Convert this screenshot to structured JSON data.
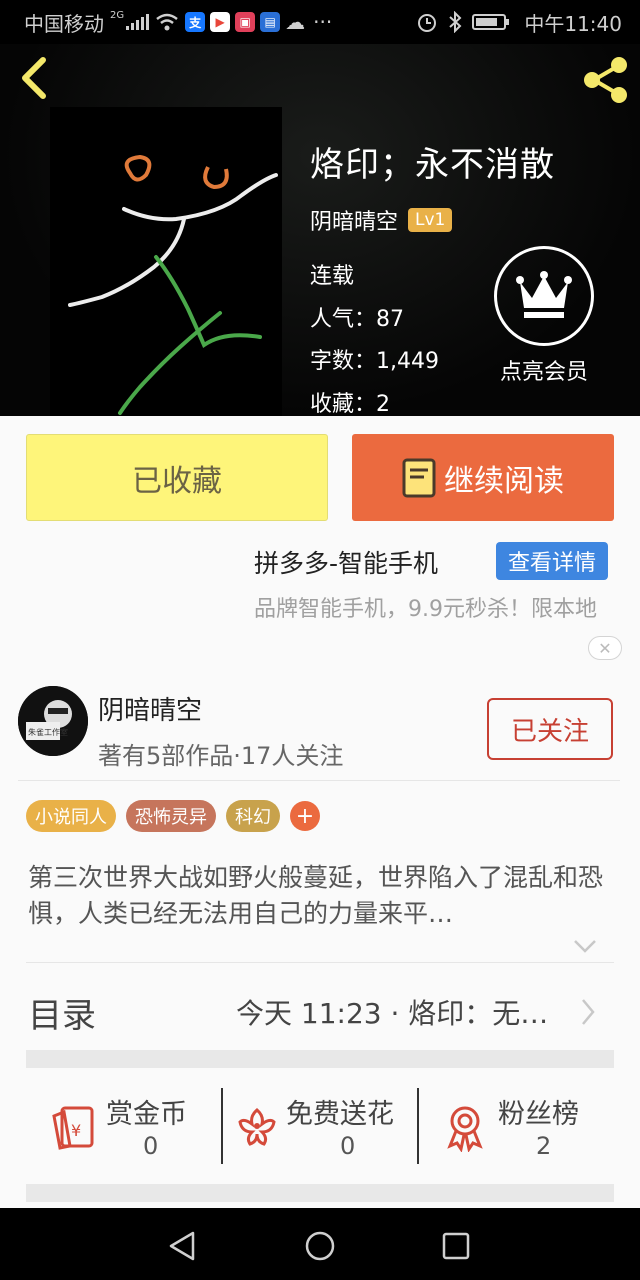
{
  "status_bar": {
    "carrier": "中国移动",
    "network": "2G",
    "time": "中午11:40",
    "more": "···",
    "app_icons": [
      {
        "name": "alipay-icon",
        "glyph": "支",
        "color": "#1677ff"
      },
      {
        "name": "video-app-icon",
        "glyph": "▶",
        "color": "#ffffff"
      },
      {
        "name": "shop-app-icon",
        "glyph": "▣",
        "color": "#e0405a"
      },
      {
        "name": "news-app-icon",
        "glyph": "▤",
        "color": "#2a6fd6"
      },
      {
        "name": "cloud-icon",
        "glyph": "☁",
        "color": "#cfcfcf"
      }
    ]
  },
  "book": {
    "title": "烙印；永不消散",
    "author": "阴暗晴空",
    "level": "Lv1",
    "status": "连载",
    "popularity": "人气：87",
    "word_count": "字数：1,449",
    "favorites": "收藏：2"
  },
  "vip": {
    "label": "点亮会员"
  },
  "buttons": {
    "favorited": "已收藏",
    "continue_reading": "继续阅读"
  },
  "ad": {
    "title": "拼多多-智能手机",
    "button": "查看详情",
    "description": "品牌智能手机，9.9元秒杀！限本地",
    "close": "✕"
  },
  "author_card": {
    "name": "阴暗晴空",
    "subtitle": "著有5部作品·17人关注",
    "follow": "已关注",
    "avatar_text": "朱雀工作室"
  },
  "tags": [
    {
      "label": "小说同人",
      "color": "#e9b148"
    },
    {
      "label": "恐怖灵异",
      "color": "#c6755c"
    },
    {
      "label": "科幻",
      "color": "#c8a24c"
    }
  ],
  "tag_add": "+",
  "synopsis": "第三次世界大战如野火般蔓延，世界陷入了混乱和恐惧，人类已经无法用自己的力量来平…",
  "toc": {
    "label": "目录",
    "latest": "今天 11:23 · 烙印：无…"
  },
  "actions": [
    {
      "label": "赏金币",
      "value": "0"
    },
    {
      "label": "免费送花",
      "value": "0"
    },
    {
      "label": "粉丝榜",
      "value": "2"
    }
  ],
  "colors": {
    "accent_orange": "#eb6a3f",
    "favorite_yellow": "#fef57a",
    "follow_red": "#c74033",
    "ad_blue": "#3e86e0",
    "level_gold": "#e9b148",
    "icon_red": "#d44a3a"
  }
}
